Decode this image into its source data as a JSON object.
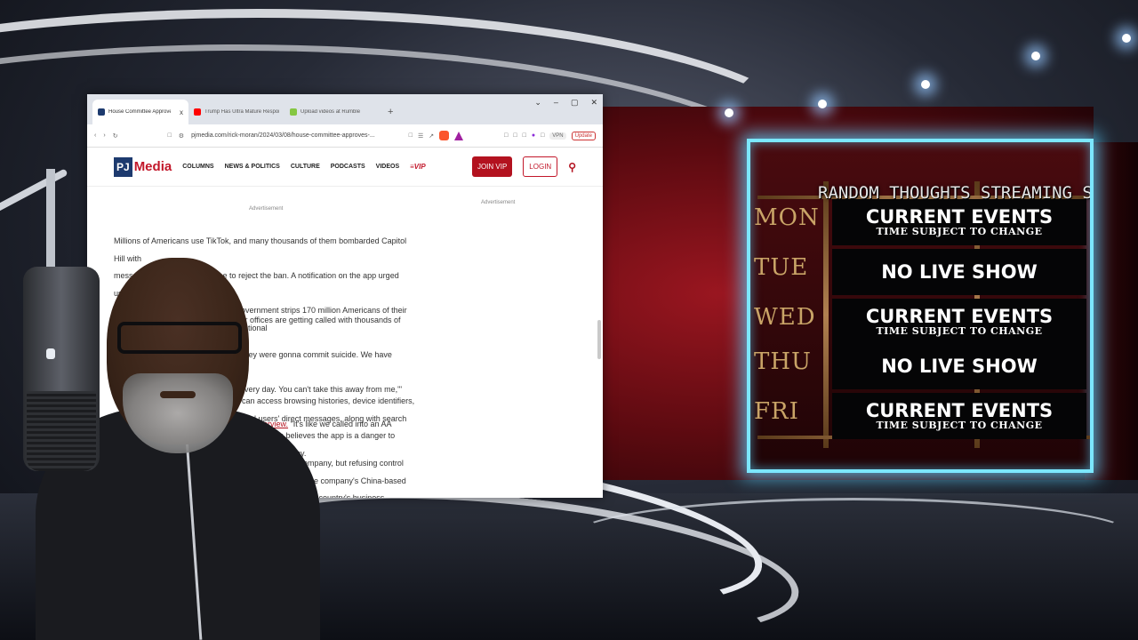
{
  "browser": {
    "tabs": [
      {
        "title": "House Committee Approves Bill",
        "favicon_color": "#1d3a6e",
        "close": "x"
      },
      {
        "title": "Trump Has Ultra Mature Response T",
        "favicon_color": "#ff0000"
      },
      {
        "title": "Upload videos at Rumble",
        "favicon_color": "#85c742"
      }
    ],
    "new_tab": "+",
    "window_controls": [
      "⌄",
      "–",
      "▢",
      "✕"
    ],
    "url": "pjmedia.com/rick-moran/2024/03/08/house-committee-approves-...",
    "vpn": "VPN",
    "update": "Update"
  },
  "site": {
    "logo_pj": "PJ",
    "logo_media": "Media",
    "nav": [
      "COLUMNS",
      "NEWS & POLITICS",
      "CULTURE",
      "PODCASTS",
      "VIDEOS"
    ],
    "vip": "VIP",
    "join_vip": "JOIN VIP",
    "login": "LOGIN",
    "ad_left": "Advertisement",
    "ad_right": "Advertisement"
  },
  "article": {
    "p1_lines": [
      "Millions of Americans use TikTok, and many thousands of them bombarded Capitol Hill with",
      "messages urging the committee to reject the ban. A notification on the app urged users to",
      "your government strips 170 million Americans of their Constitutional"
    ],
    "p2_lines": [
      "hen our offices are getting called with thousands of people",
      "] said they were gonna commit suicide. We have people",
      "long, every day. You can't take this away from me,\"' Rep."
    ],
    "p2_link": "ess in an interview.",
    "p2_after_link": " \"It's like we called into an AA meeting.\"",
    "p3_lines": [
      "ok can access browsing histories, device identifiers,",
      "nd users' direct messages, along with search",
      "h believes the app is a danger to privacy."
    ],
    "p4_lines": [
      "rivate company, but refusing control",
      "ion for the company's China-based",
      "hing the country's business"
    ]
  },
  "schedule": {
    "title": "RANDOM THOUGHTS STREAMING S",
    "rows": [
      {
        "day": "MON",
        "show": "CURRENT EVENTS",
        "note": "TIME SUBJECT TO CHANGE"
      },
      {
        "day": "TUE",
        "show": "NO LIVE SHOW",
        "note": ""
      },
      {
        "day": "WED",
        "show": "CURRENT EVENTS",
        "note": "TIME SUBJECT TO CHANGE"
      },
      {
        "day": "THU",
        "show": "NO LIVE SHOW",
        "note": ""
      },
      {
        "day": "FRI",
        "show": "CURRENT EVENTS",
        "note": "TIME SUBJECT TO CHANGE"
      }
    ],
    "border_color": "#7ce7ff"
  }
}
